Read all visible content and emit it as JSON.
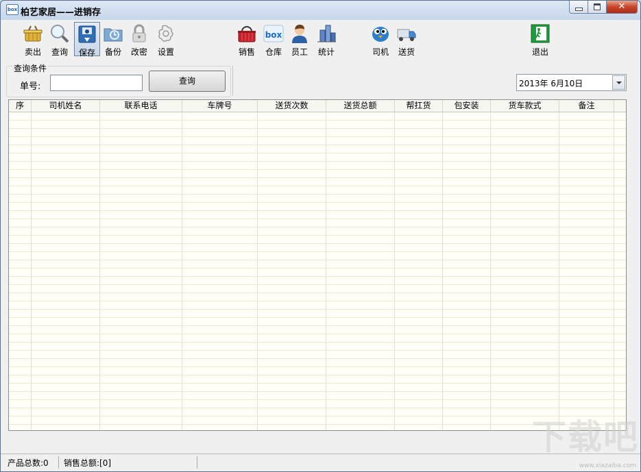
{
  "window": {
    "title": "柏艺家居——进销存",
    "logo_text": "box",
    "close_glyph": "✕"
  },
  "toolbar": {
    "items": [
      {
        "label": "卖出",
        "icon": "basket-icon"
      },
      {
        "label": "查询",
        "icon": "magnifier-icon"
      },
      {
        "label": "保存",
        "icon": "save-icon",
        "active": true
      },
      {
        "label": "备份",
        "icon": "backup-folder-icon"
      },
      {
        "label": "改密",
        "icon": "padlock-icon"
      },
      {
        "label": "设置",
        "icon": "gear-icon"
      },
      {
        "label": "销售",
        "icon": "shopping-basket-icon"
      },
      {
        "label": "仓库",
        "icon": "box-logo-icon"
      },
      {
        "label": "员工",
        "icon": "employee-icon"
      },
      {
        "label": "统计",
        "icon": "stats-building-icon"
      },
      {
        "label": "司机",
        "icon": "driver-bird-icon"
      },
      {
        "label": "送货",
        "icon": "delivery-truck-icon"
      },
      {
        "label": "退出",
        "icon": "exit-door-icon"
      }
    ]
  },
  "query": {
    "group_title": "查询条件",
    "order_label": "单号:",
    "order_value": "",
    "button_label": "查询"
  },
  "date_picker": {
    "value": "2013年  6月10日"
  },
  "table": {
    "columns": [
      "序",
      "司机姓名",
      "联系电话",
      "车牌号",
      "送货次数",
      "送货总额",
      "帮扛货",
      "包安装",
      "货车款式",
      "备注"
    ],
    "rows": []
  },
  "status": {
    "product_total": "产品总数:0",
    "sales_total": "销售总额:[0]"
  },
  "watermark": {
    "text": "下载吧",
    "sub": "www.xiazaiba.com"
  },
  "colors": {
    "title_gradient_top": "#dce8f5",
    "close_button": "#c7452a",
    "grid_background": "#fffff7",
    "grid_line": "#ebebd6"
  }
}
